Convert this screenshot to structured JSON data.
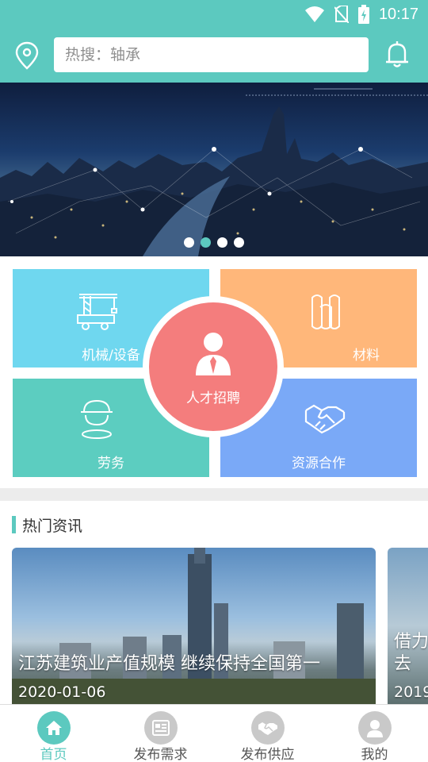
{
  "status": {
    "time": "10:17"
  },
  "search": {
    "placeholder": "热搜：轴承"
  },
  "banner": {
    "slide_count": 4,
    "active_slide": 2
  },
  "categories": {
    "machine": "机械/设备",
    "material": "材料",
    "labor": "劳务",
    "resource": "资源合作",
    "recruit": "人才招聘"
  },
  "news": {
    "section_title": "热门资讯",
    "items": [
      {
        "title": "江苏建筑业产值规模 继续保持全国第一",
        "date": "2020-01-06"
      },
      {
        "title_line1": "借力",
        "title_line2": "去",
        "date": "2019"
      }
    ]
  },
  "tabs": [
    {
      "label": "首页",
      "icon": "home-icon",
      "active": true
    },
    {
      "label": "发布需求",
      "icon": "newspaper-icon",
      "active": false
    },
    {
      "label": "发布供应",
      "icon": "handshake-icon",
      "active": false
    },
    {
      "label": "我的",
      "icon": "user-icon",
      "active": false
    }
  ],
  "colors": {
    "primary": "#5cc9bf",
    "machine": "#6fd7ef",
    "material": "#ffb77a",
    "labor": "#5ccdc0",
    "resource": "#7aa9f7",
    "recruit": "#f47d7d"
  }
}
